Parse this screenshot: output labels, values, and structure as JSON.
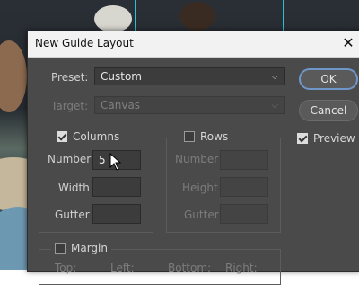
{
  "dialog": {
    "title": "New Guide Layout",
    "preset": {
      "label": "Preset:",
      "value": "Custom"
    },
    "target": {
      "label": "Target:",
      "value": "Canvas"
    },
    "columns": {
      "label": "Columns",
      "checked": true,
      "number": {
        "label": "Number",
        "value": "5"
      },
      "width": {
        "label": "Width",
        "value": ""
      },
      "gutter": {
        "label": "Gutter",
        "value": ""
      }
    },
    "rows": {
      "label": "Rows",
      "checked": false,
      "number": {
        "label": "Number",
        "value": ""
      },
      "height": {
        "label": "Height",
        "value": ""
      },
      "gutter": {
        "label": "Gutter",
        "value": ""
      }
    },
    "margin": {
      "label": "Margin",
      "checked": false,
      "top": "Top:",
      "left": "Left:",
      "bottom": "Bottom:",
      "right": "Right:"
    },
    "buttons": {
      "ok": "OK",
      "cancel": "Cancel"
    },
    "preview": {
      "label": "Preview",
      "checked": true
    }
  },
  "icons": {
    "close": "close-icon",
    "dropdown": "chevron-down-icon",
    "cursor": "mouse-pointer-icon"
  },
  "colors": {
    "dialog_bg": "#4a4a4a",
    "titlebar_bg": "#f2f2f2",
    "ok_border": "#6f96c9",
    "guide": "#2ad1e6"
  }
}
